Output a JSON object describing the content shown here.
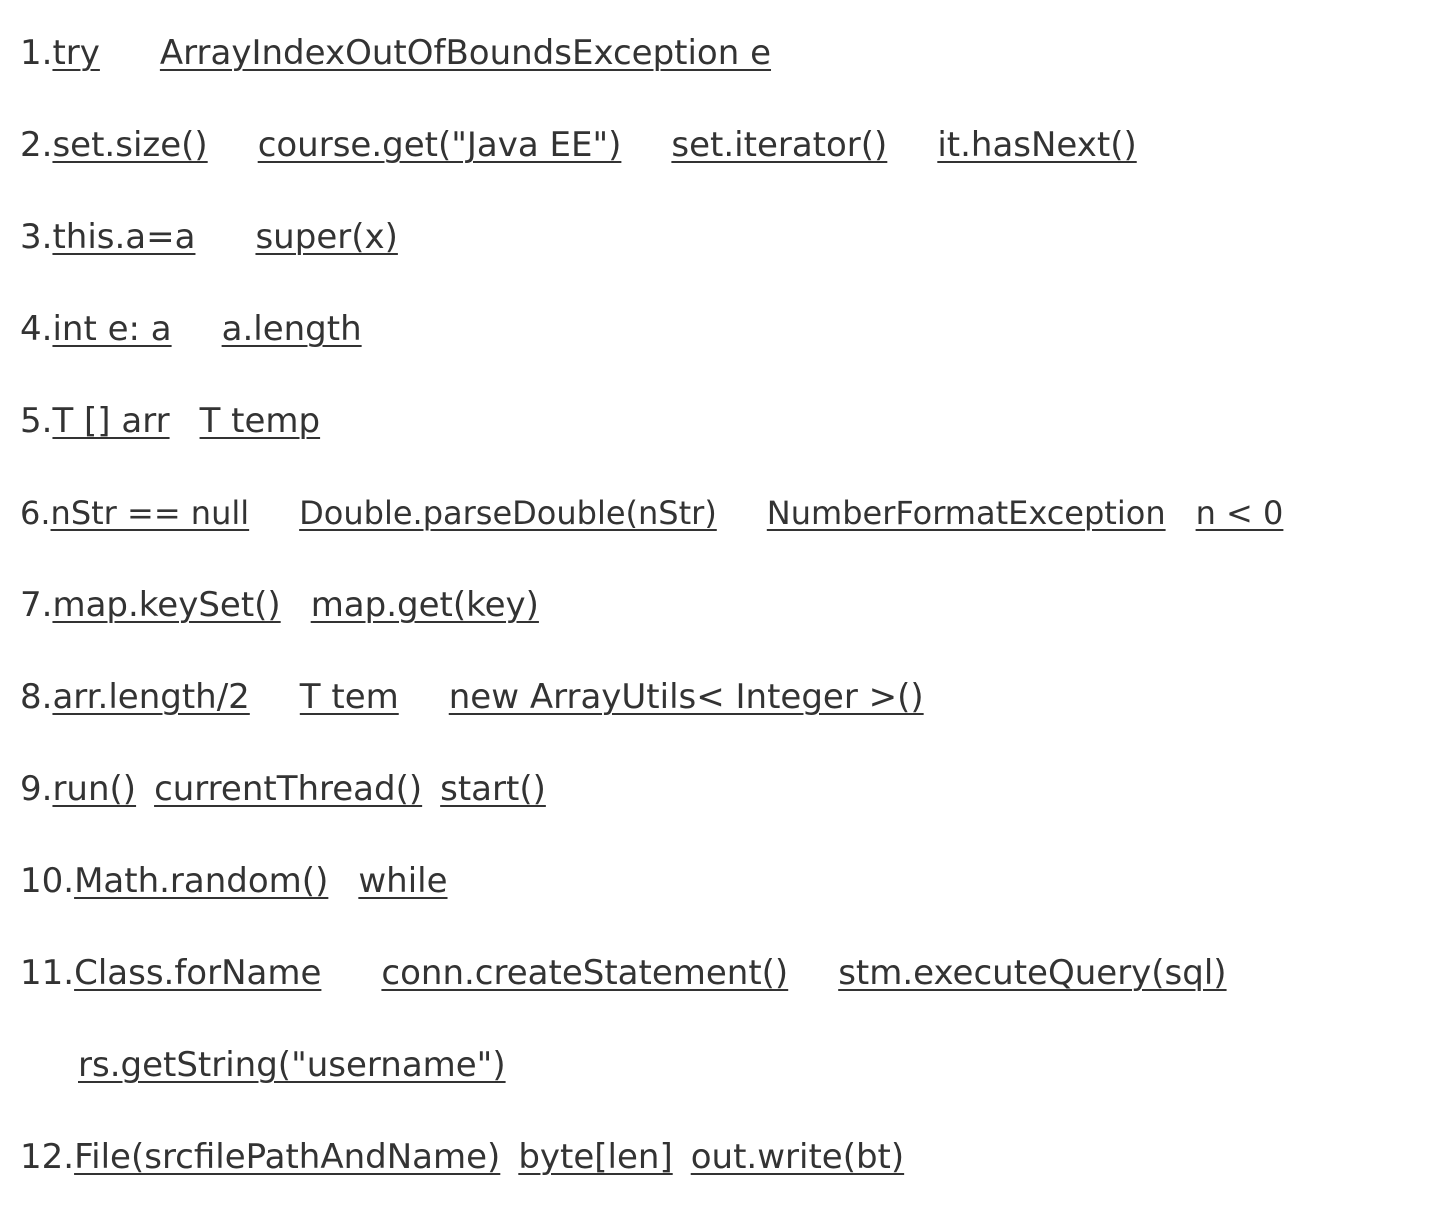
{
  "items": [
    {
      "num": "1.",
      "answers": [
        "try",
        "ArrayIndexOutOfBoundsException e"
      ]
    },
    {
      "num": "2.",
      "answers": [
        "set.size()",
        "course.get(\"Java EE\")",
        "set.iterator()",
        "it.hasNext()"
      ]
    },
    {
      "num": "3.",
      "answers": [
        "this.a=a",
        "super(x)"
      ]
    },
    {
      "num": "4.",
      "answers": [
        "int e: a",
        "a.length"
      ]
    },
    {
      "num": "5.",
      "answers": [
        "T [] arr",
        "T temp"
      ]
    },
    {
      "num": "6.",
      "answers": [
        "nStr == null",
        "Double.parseDouble(nStr)",
        "NumberFormatException",
        "n < 0"
      ]
    },
    {
      "num": "7.",
      "answers": [
        "map.keySet()",
        "map.get(key)"
      ]
    },
    {
      "num": "8.",
      "answers": [
        "arr.length/2",
        "T tem",
        "new ArrayUtils< Integer >()"
      ]
    },
    {
      "num": "9.",
      "answers": [
        "run()",
        "currentThread()",
        "start()"
      ]
    },
    {
      "num": "10.",
      "answers": [
        "Math.random()",
        "while"
      ]
    },
    {
      "num": "11.",
      "answers": [
        "Class.forName",
        "conn.createStatement()",
        "stm.executeQuery(sql)"
      ]
    },
    {
      "num": "",
      "answers": [
        "rs.getString(\"username\")"
      ]
    },
    {
      "num": "12.",
      "answers": [
        "File(srcfilePathAndName)",
        "byte[len]",
        "out.write(bt)"
      ]
    }
  ]
}
